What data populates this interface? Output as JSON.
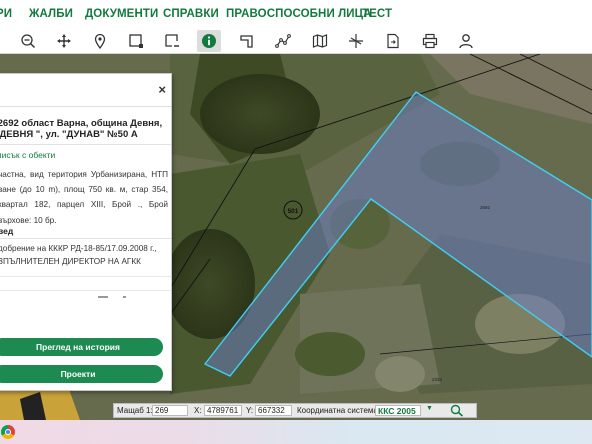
{
  "nav": {
    "items": [
      "РИ",
      "ЖАЛБИ",
      "ДОКУМЕНТИ",
      "СПРАВКИ",
      "ПРАВОСПОСОБНИ ЛИЦА",
      "ТЕСТ"
    ]
  },
  "toolbar": {
    "tools": [
      "zoom-out-icon",
      "pan-icon",
      "map-pin-icon",
      "select-rectangle-icon",
      "clear-selection-icon",
      "info-icon",
      "measure-area-icon",
      "measure-distance-icon",
      "map-icon",
      "split-icon",
      "export-icon",
      "print-icon",
      "user-icon"
    ],
    "active": "info-icon"
  },
  "map": {
    "parcel_label": "501",
    "parcel_number": "2692",
    "neighbor_number": "2333"
  },
  "panel": {
    "close": "×",
    "title_line1": ".2692 област Варна, община Девня,",
    "title_line2": "\"ДЕВНЯ \", ул. \"ДУНАВ\" №50 А",
    "back_link": "писък с обекти",
    "description": "частна, вид територия Урбанизирана, НТП ване (до 10 m), площ 750 кв. м, стар 354, квартал 182, парцел XIII, Брой ., Брой върхове: 10 бр.",
    "section_title": "вед",
    "approval": "добрение на КККР РД-18-85/17.09.2008 г., ЗПЪЛНИТЕЛЕН ДИРЕКТОР НА АГКК",
    "history_button": "Преглед на история",
    "projects_button": "Проекти"
  },
  "status": {
    "scale_label": "Мащаб 1:",
    "scale_value": "269",
    "x_label": "X:",
    "x_value": "4789761",
    "y_label": "Y:",
    "y_value": "667332",
    "crs_label": "Координатна система:",
    "crs_value": "ККС 2005",
    "dropdown_arrow": "▼"
  },
  "colors": {
    "brand_green": "#127a3e",
    "button_green": "#1d8a52",
    "parcel_outline": "#3fd0f2"
  }
}
